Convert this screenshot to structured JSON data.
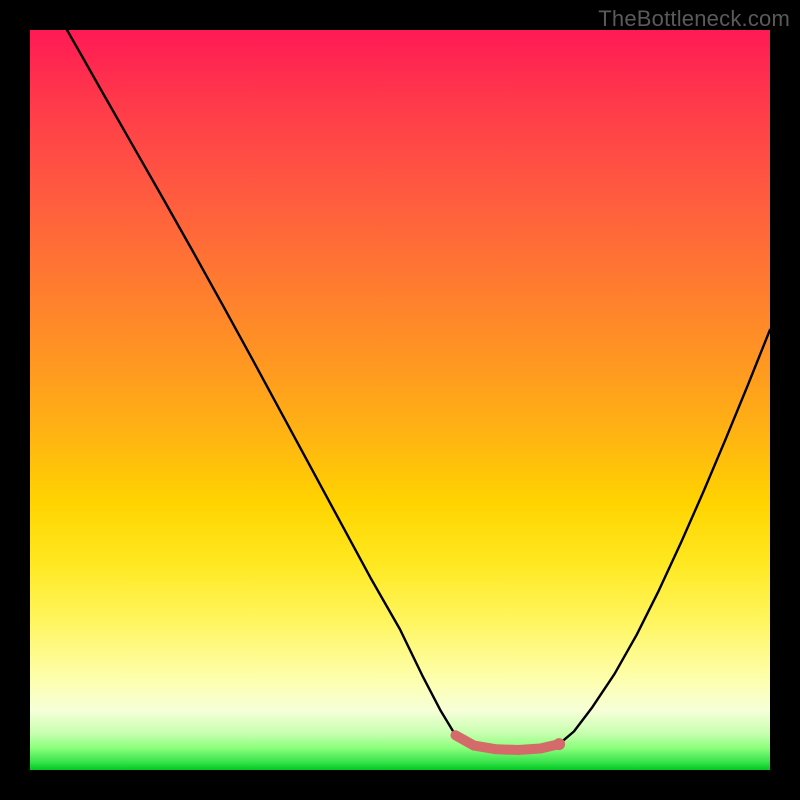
{
  "watermark": "TheBottleneck.com",
  "colors": {
    "curve": "#000000",
    "flat_segment": "#d46a6a",
    "flat_segment_dot": "#d46a6a",
    "frame": "#000000"
  },
  "chart_data": {
    "type": "line",
    "title": "",
    "xlabel": "",
    "ylabel": "",
    "xlim": [
      0,
      1
    ],
    "ylim": [
      0,
      1
    ],
    "note": "Axes are implied (no tick labels in image). x is horizontal 0→1 left→right; y is 0 at bottom (green) → 1 at top (red). Curve is a V with flat bottom between x≈0.57 and x≈0.72 at y≈0.03.",
    "series": [
      {
        "name": "curve",
        "x": [
          0.05,
          0.07,
          0.1,
          0.14,
          0.18,
          0.22,
          0.26,
          0.3,
          0.34,
          0.38,
          0.42,
          0.46,
          0.5,
          0.53,
          0.555,
          0.575,
          0.6,
          0.63,
          0.66,
          0.69,
          0.715,
          0.735,
          0.76,
          0.79,
          0.82,
          0.85,
          0.88,
          0.91,
          0.94,
          0.97,
          1.0
        ],
        "y": [
          1.0,
          0.965,
          0.912,
          0.842,
          0.772,
          0.701,
          0.629,
          0.556,
          0.482,
          0.408,
          0.334,
          0.26,
          0.19,
          0.128,
          0.08,
          0.047,
          0.033,
          0.028,
          0.027,
          0.029,
          0.035,
          0.052,
          0.085,
          0.13,
          0.183,
          0.243,
          0.308,
          0.376,
          0.447,
          0.52,
          0.595
        ]
      }
    ],
    "flat_segment": {
      "name": "bottom-highlight",
      "x": [
        0.575,
        0.6,
        0.63,
        0.66,
        0.69,
        0.715
      ],
      "y": [
        0.047,
        0.033,
        0.028,
        0.027,
        0.029,
        0.035
      ]
    }
  }
}
